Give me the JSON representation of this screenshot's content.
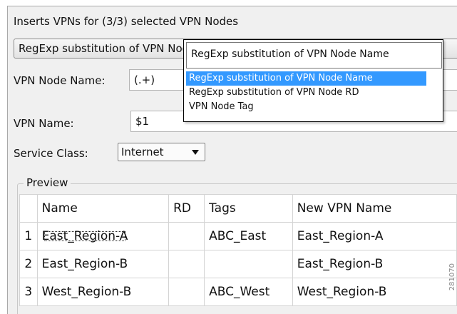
{
  "header": {
    "description": "Inserts VPNs for (3/3) selected VPN Nodes"
  },
  "substitution_combo": {
    "value": "RegExp substitution of VPN Node Name"
  },
  "dropdown": {
    "current_value": "RegExp substitution of VPN Node Name",
    "options": [
      {
        "label": "RegExp substitution of VPN Node Name",
        "selected": true
      },
      {
        "label": "RegExp substitution of VPN Node RD",
        "selected": false
      },
      {
        "label": "VPN Node Tag",
        "selected": false
      }
    ]
  },
  "form": {
    "vpn_node_name_label": "VPN Node Name:",
    "vpn_node_name_value": "(.+)",
    "vpn_name_label": "VPN Name:",
    "vpn_name_value": "$1",
    "service_class_label": "Service Class:",
    "service_class_value": "Internet"
  },
  "preview": {
    "legend": "Preview",
    "columns": [
      "Name",
      "RD",
      "Tags",
      "New VPN Name"
    ],
    "rows": [
      {
        "num": "1",
        "name": "East_Region-A",
        "rd": "",
        "tags": "ABC_East",
        "new_name": "East_Region-A"
      },
      {
        "num": "2",
        "name": "East_Region-B",
        "rd": "",
        "tags": "",
        "new_name": "East_Region-B"
      },
      {
        "num": "3",
        "name": "West_Region-B",
        "rd": "",
        "tags": "ABC_West",
        "new_name": "West_Region-B"
      }
    ]
  },
  "watermark": "281070",
  "colors": {
    "selection": "#3399ff",
    "panel_background": "#f0f0f0"
  }
}
